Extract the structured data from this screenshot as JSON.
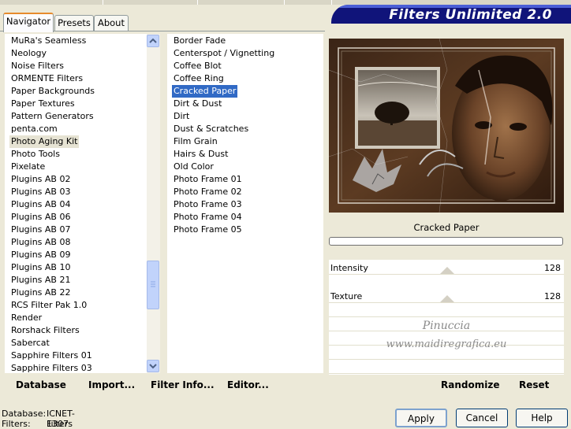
{
  "tabs": [
    "Navigator",
    "Presets",
    "About"
  ],
  "banner_title": "Filters Unlimited 2.0",
  "categories": [
    "MuRa's Seamless",
    "Neology",
    "Noise Filters",
    "ORMENTE Filters",
    "Paper Backgrounds",
    "Paper Textures",
    "Pattern Generators",
    "penta.com",
    "Photo Aging Kit",
    "Photo Tools",
    "Pixelate",
    "Plugins AB 02",
    "Plugins AB 03",
    "Plugins AB 04",
    "Plugins AB 06",
    "Plugins AB 07",
    "Plugins AB 08",
    "Plugins AB 09",
    "Plugins AB 10",
    "Plugins AB 21",
    "Plugins AB 22",
    "RCS Filter Pak 1.0",
    "Render",
    "Rorshack Filters",
    "Sabercat",
    "Sapphire Filters 01",
    "Sapphire Filters 03"
  ],
  "selected_category": "Photo Aging Kit",
  "filters": [
    "Border Fade",
    "Centerspot / Vignetting",
    "Coffee Blot",
    "Coffee Ring",
    "Cracked Paper",
    "Dirt & Dust",
    "Dirt",
    "Dust & Scratches",
    "Film Grain",
    "Hairs & Dust",
    "Old Color",
    "Photo Frame 01",
    "Photo Frame 02",
    "Photo Frame 03",
    "Photo Frame 04",
    "Photo Frame 05"
  ],
  "selected_filter": "Cracked Paper",
  "preview_filter_name": "Cracked Paper",
  "progress": 0,
  "sliders": [
    {
      "label": "Intensity",
      "value": "128",
      "fraction": 0.502
    },
    {
      "label": "Texture",
      "value": "128",
      "fraction": 0.502
    }
  ],
  "watermark": {
    "line1": "Pinuccia",
    "line2": "www.maidiregrafica.eu"
  },
  "left_buttons": {
    "database": "Database",
    "import": "Import...",
    "filter_info": "Filter Info...",
    "editor": "Editor..."
  },
  "right_buttons": {
    "randomize": "Randomize",
    "reset": "Reset"
  },
  "status": {
    "database_label": "Database:",
    "database_value": "ICNET-Filters",
    "filters_label": "Filters:",
    "filters_value": "1307"
  },
  "dialog_buttons": {
    "apply": "Apply",
    "cancel": "Cancel",
    "help": "Help"
  },
  "colors": {
    "accent_tab": "#e68b2c",
    "banner": "#10147a",
    "selection": "#316ac5"
  }
}
